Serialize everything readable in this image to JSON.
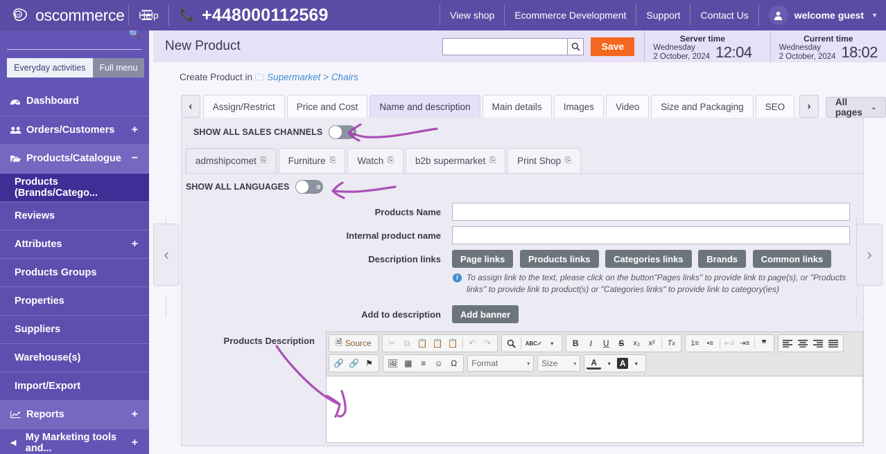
{
  "topbar": {
    "brand": "oscommerce",
    "menu_icon": "hamburger-icon",
    "help": "Help",
    "phone_icon": "phone-icon",
    "phone": "+448000112569",
    "links": [
      "View shop",
      "Ecommerce Development",
      "Support",
      "Contact Us"
    ],
    "user": "welcome guest",
    "avatar_icon": "user-icon",
    "caret": "▼"
  },
  "sidebar": {
    "search_icon": "search-icon",
    "mode_active": "Everyday activities",
    "mode_inactive": "Full menu",
    "items": [
      {
        "label": "Dashboard",
        "icon": "dashboard-icon",
        "expand": ""
      },
      {
        "label": "Orders/Customers",
        "icon": "users-icon",
        "expand": "+"
      },
      {
        "label": "Products/Catalogue",
        "icon": "folder-open-icon",
        "expand": "−"
      },
      {
        "label": "Reports",
        "icon": "chart-line-icon",
        "expand": "+"
      },
      {
        "label": "My Marketing tools and...",
        "icon": "megaphone-icon",
        "expand": "+"
      }
    ],
    "sub_items": [
      {
        "label": "Products (Brands/Catego...",
        "expand": ""
      },
      {
        "label": "Reviews",
        "expand": ""
      },
      {
        "label": "Attributes",
        "expand": "+"
      },
      {
        "label": "Products Groups",
        "expand": ""
      },
      {
        "label": "Properties",
        "expand": ""
      },
      {
        "label": "Suppliers",
        "expand": ""
      },
      {
        "label": "Warehouse(s)",
        "expand": ""
      },
      {
        "label": "Import/Export",
        "expand": ""
      }
    ]
  },
  "page_head": {
    "title": "New Product",
    "search_value": "",
    "search_icon": "search-icon",
    "save_label": "Save",
    "server_time_label": "Server time",
    "server_time_day": "Wednesday",
    "server_time_date": "2 October, 2024",
    "server_time_clock": "12:04",
    "current_time_label": "Current time",
    "current_time_day": "Wednesday",
    "current_time_date": "2 October, 2024",
    "current_time_clock": "18:02"
  },
  "breadcrumb": {
    "prefix": "Create Product in",
    "folder_icon": "folder-icon",
    "category": "Supermarket",
    "separator": ">",
    "subcategory": "Chairs"
  },
  "tabs": {
    "prev_icon": "chevron-left-icon",
    "next_icon": "chevron-right-icon",
    "items": [
      {
        "label": "Assign/Restrict",
        "active": false
      },
      {
        "label": "Price and Cost",
        "active": false
      },
      {
        "label": "Name and description",
        "active": true
      },
      {
        "label": "Main details",
        "active": false
      },
      {
        "label": "Images",
        "active": false
      },
      {
        "label": "Video",
        "active": false
      },
      {
        "label": "Size and Packaging",
        "active": false
      },
      {
        "label": "SEO",
        "active": false
      }
    ],
    "all_pages": "All pages",
    "all_pages_caret": "⌄"
  },
  "panel": {
    "sales_channels_label": "SHOW ALL SALES CHANNELS",
    "toggle_off_mark": "o",
    "channel_tabs": [
      {
        "label": "admshipcomet",
        "active": true,
        "icon": "copy-icon"
      },
      {
        "label": "Furniture",
        "active": false,
        "icon": "copy-icon"
      },
      {
        "label": "Watch",
        "active": false,
        "icon": "copy-icon"
      },
      {
        "label": "b2b supermarket",
        "active": false,
        "icon": "copy-icon"
      },
      {
        "label": "Print Shop",
        "active": false,
        "icon": "copy-icon"
      }
    ],
    "languages_label": "SHOW ALL LANGUAGES"
  },
  "form": {
    "products_name_label": "Products Name",
    "products_name_value": "",
    "internal_name_label": "Internal product name",
    "internal_name_value": "",
    "description_links_label": "Description links",
    "link_buttons": [
      "Page links",
      "Products links",
      "Categories links",
      "Brands",
      "Common links"
    ],
    "hint_icon": "info-icon",
    "hint_text": "To assign link to the text, please click on the button\"Pages links\" to provide link to page(s), or \"Products links\" to provide link to product(s) or \"Categories links\" to provide link to category(ies)",
    "add_to_description_label": "Add to description",
    "add_banner_label": "Add banner",
    "products_description_label": "Products Description"
  },
  "editor": {
    "source_label": "Source",
    "source_icon": "source-icon",
    "row1": [
      {
        "icon": "cut-icon",
        "glyph": "✂",
        "disabled": true
      },
      {
        "icon": "copy-icon",
        "glyph": "⧉",
        "disabled": true
      },
      {
        "icon": "paste-icon",
        "glyph": "📋",
        "disabled": false
      },
      {
        "icon": "paste-text-icon",
        "glyph": "📋",
        "disabled": false
      },
      {
        "icon": "paste-word-icon",
        "glyph": "📋",
        "disabled": false
      },
      {
        "icon": "undo-icon",
        "glyph": "↶",
        "disabled": true
      },
      {
        "icon": "redo-icon",
        "glyph": "↷",
        "disabled": true
      },
      {
        "icon": "find-icon",
        "glyph": "🔍",
        "disabled": false
      },
      {
        "icon": "spellcheck-icon",
        "glyph": "ABC",
        "disabled": false
      },
      {
        "icon": "bold-icon",
        "glyph": "B",
        "disabled": false
      },
      {
        "icon": "italic-icon",
        "glyph": "I",
        "disabled": false
      },
      {
        "icon": "underline-icon",
        "glyph": "U",
        "disabled": false
      },
      {
        "icon": "strike-icon",
        "glyph": "S",
        "disabled": false
      },
      {
        "icon": "subscript-icon",
        "glyph": "x₂",
        "disabled": false
      },
      {
        "icon": "superscript-icon",
        "glyph": "x²",
        "disabled": false
      },
      {
        "icon": "remove-format-icon",
        "glyph": "Tx",
        "disabled": false
      },
      {
        "icon": "numbered-list-icon",
        "glyph": "≔",
        "disabled": false
      },
      {
        "icon": "bulleted-list-icon",
        "glyph": "⁞≡",
        "disabled": false
      },
      {
        "icon": "outdent-icon",
        "glyph": "⇤",
        "disabled": true
      },
      {
        "icon": "indent-icon",
        "glyph": "⇥",
        "disabled": false
      },
      {
        "icon": "blockquote-icon",
        "glyph": "❞",
        "disabled": false
      },
      {
        "icon": "align-left-icon",
        "glyph": "≡",
        "disabled": false
      },
      {
        "icon": "align-center-icon",
        "glyph": "≡",
        "disabled": false
      },
      {
        "icon": "align-right-icon",
        "glyph": "≡",
        "disabled": false
      },
      {
        "icon": "justify-icon",
        "glyph": "≡",
        "disabled": false
      }
    ],
    "row2": [
      {
        "icon": "link-icon",
        "glyph": "🔗",
        "disabled": false
      },
      {
        "icon": "unlink-icon",
        "glyph": "⛓",
        "disabled": true
      },
      {
        "icon": "anchor-icon",
        "glyph": "⚑",
        "disabled": false
      },
      {
        "icon": "image-icon",
        "glyph": "🖼",
        "disabled": false
      },
      {
        "icon": "table-icon",
        "glyph": "▦",
        "disabled": false
      },
      {
        "icon": "horizontal-rule-icon",
        "glyph": "▬",
        "disabled": false
      },
      {
        "icon": "smiley-icon",
        "glyph": "☺",
        "disabled": false
      },
      {
        "icon": "special-char-icon",
        "glyph": "Ω",
        "disabled": false
      }
    ],
    "format_select": "Format",
    "size_select": "Size",
    "text_color_label": "A",
    "bg_color_label": "A",
    "content": ""
  },
  "carousel": {
    "prev_icon": "chevron-left-icon",
    "next_icon": "chevron-right-icon"
  },
  "colors": {
    "brand_purple": "#5c4ba4",
    "sidebar_purple": "#6355b5",
    "sidebar_active": "#3d2f96",
    "header_lavender": "#e6e1f7",
    "save_orange": "#f4671f",
    "link_blue": "#3d8fd4",
    "annotation_purple": "#a23bb0"
  }
}
